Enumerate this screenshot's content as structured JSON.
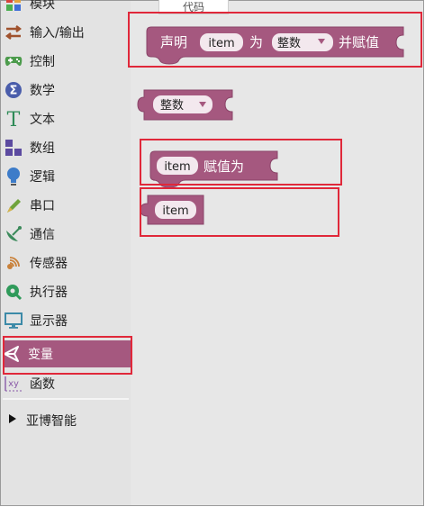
{
  "top_tab_label": "代码",
  "sidebar": {
    "items": [
      {
        "label": "模块",
        "icon": "puzzle-icon",
        "color": "#d9433a"
      },
      {
        "label": "输入/输出",
        "icon": "io-arrows-icon",
        "color": "#a0522d"
      },
      {
        "label": "控制",
        "icon": "gamepad-icon",
        "color": "#4c9b4c"
      },
      {
        "label": "数学",
        "icon": "sigma-icon",
        "color": "#4a5dab"
      },
      {
        "label": "文本",
        "icon": "text-t-icon",
        "color": "#2e8b57"
      },
      {
        "label": "数组",
        "icon": "array-blocks-icon",
        "color": "#5c4aa0"
      },
      {
        "label": "逻辑",
        "icon": "lightbulb-icon",
        "color": "#3d7cc9"
      },
      {
        "label": "串口",
        "icon": "serial-pen-icon",
        "color": "#6fa33b"
      },
      {
        "label": "通信",
        "icon": "satellite-dish-icon",
        "color": "#3b8a5b"
      },
      {
        "label": "传感器",
        "icon": "sensor-waves-icon",
        "color": "#c9813a"
      },
      {
        "label": "执行器",
        "icon": "actuator-icon",
        "color": "#2f9a5a"
      },
      {
        "label": "显示器",
        "icon": "monitor-icon",
        "color": "#3c8aa8"
      },
      {
        "label": "变量",
        "icon": "unity-variable-icon",
        "color": "#ffffff",
        "active": true
      },
      {
        "label": "函数",
        "icon": "function-xy-icon",
        "color": "#8a5aa8"
      }
    ],
    "group": {
      "label": "亚博智能",
      "icon": "triangle-right-icon"
    }
  },
  "blocks": {
    "declare": {
      "prefix": "声明",
      "var_name": "item",
      "as_word": "为",
      "type_label": "整数",
      "suffix": "并赋值"
    },
    "type_block": {
      "label": "整数"
    },
    "assign": {
      "var_name": "item",
      "label": "赋值为"
    },
    "getter": {
      "var_name": "item"
    }
  },
  "colors": {
    "block": "#a5587f",
    "block_dark": "#8a4468",
    "pill_bg": "#f3e8ee",
    "highlight": "#e0283a",
    "active_sidebar": "#a5587f"
  }
}
